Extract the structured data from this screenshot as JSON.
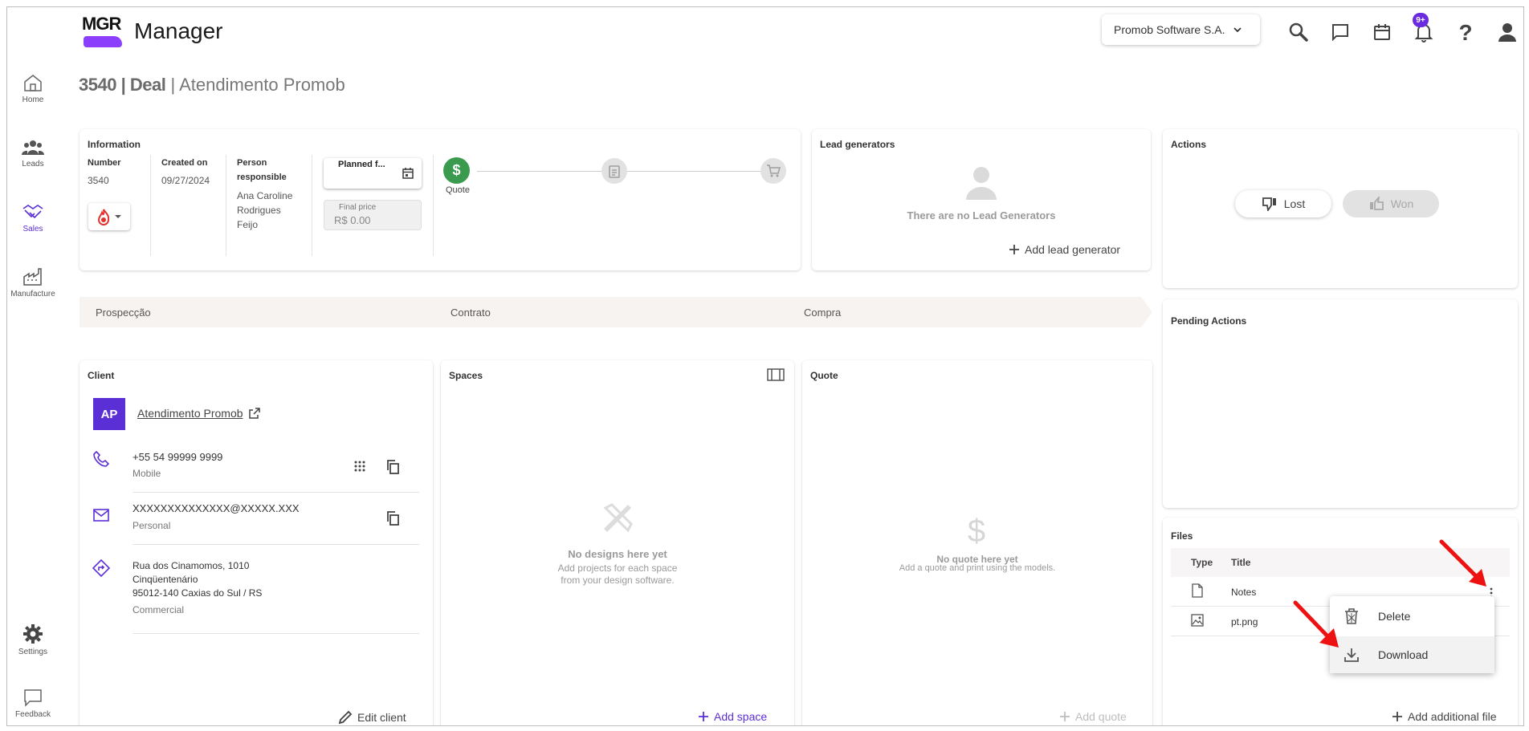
{
  "app": {
    "logo_text": "MGR",
    "title": "Manager"
  },
  "header": {
    "company": "Promob Software S.A.",
    "notif_count": "9+"
  },
  "sidebar": {
    "items": [
      {
        "label": "Home",
        "icon": "home-icon"
      },
      {
        "label": "Leads",
        "icon": "people-icon"
      },
      {
        "label": "Sales",
        "icon": "handshake-icon"
      },
      {
        "label": "Manufacture",
        "icon": "factory-icon"
      }
    ],
    "settings": "Settings",
    "feedback": "Feedback"
  },
  "page": {
    "id": "3540",
    "type": "Deal",
    "name": "Atendimento Promob"
  },
  "information": {
    "title": "Information",
    "number_label": "Number",
    "number": "3540",
    "created_label": "Created on",
    "created": "09/27/2024",
    "person_label_1": "Person",
    "person_label_2": "responsible",
    "person_1": "Ana Caroline",
    "person_2": "Rodrigues",
    "person_3": "Feijo",
    "planned_label": "Planned f...",
    "final_price_label": "Final price",
    "final_price": "R$ 0.00",
    "progress_first_label": "Quote"
  },
  "lead_generators": {
    "title": "Lead generators",
    "empty": "There are no Lead Generators",
    "add": "Add lead generator"
  },
  "actions": {
    "title": "Actions",
    "lost": "Lost",
    "won": "Won"
  },
  "stages": [
    "Prospecção",
    "Contrato",
    "Compra"
  ],
  "pending": {
    "title": "Pending Actions"
  },
  "client": {
    "title": "Client",
    "initials": "AP",
    "name": "Atendimento Promob",
    "phone": "+55 54 99999 9999",
    "phone_type": "Mobile",
    "email": "XXXXXXXXXXXXXX@XXXXX.XXX",
    "email_type": "Personal",
    "address_1": "Rua dos Cinamomos, 1010",
    "address_2": "Cinqüentenário",
    "address_3": "95012-140 Caxias do Sul / RS",
    "address_type": "Commercial",
    "edit": "Edit client"
  },
  "spaces": {
    "title": "Spaces",
    "empty": "No designs here yet",
    "hint_1": "Add projects for each space",
    "hint_2": "from your design software.",
    "add": "Add space"
  },
  "quote": {
    "title": "Quote",
    "empty": "No quote here yet",
    "hint": "Add a quote and print using the models.",
    "add": "Add quote"
  },
  "files": {
    "title": "Files",
    "col_type": "Type",
    "col_title": "Title",
    "rows": [
      {
        "title": "Notes",
        "icon": "file-icon"
      },
      {
        "title": "pt.png",
        "icon": "image-icon"
      }
    ],
    "add": "Add additional file"
  },
  "context_menu": {
    "delete": "Delete",
    "download": "Download"
  },
  "colors": {
    "accent": "#5b2fd6",
    "quote_green": "#3a9a4e"
  }
}
